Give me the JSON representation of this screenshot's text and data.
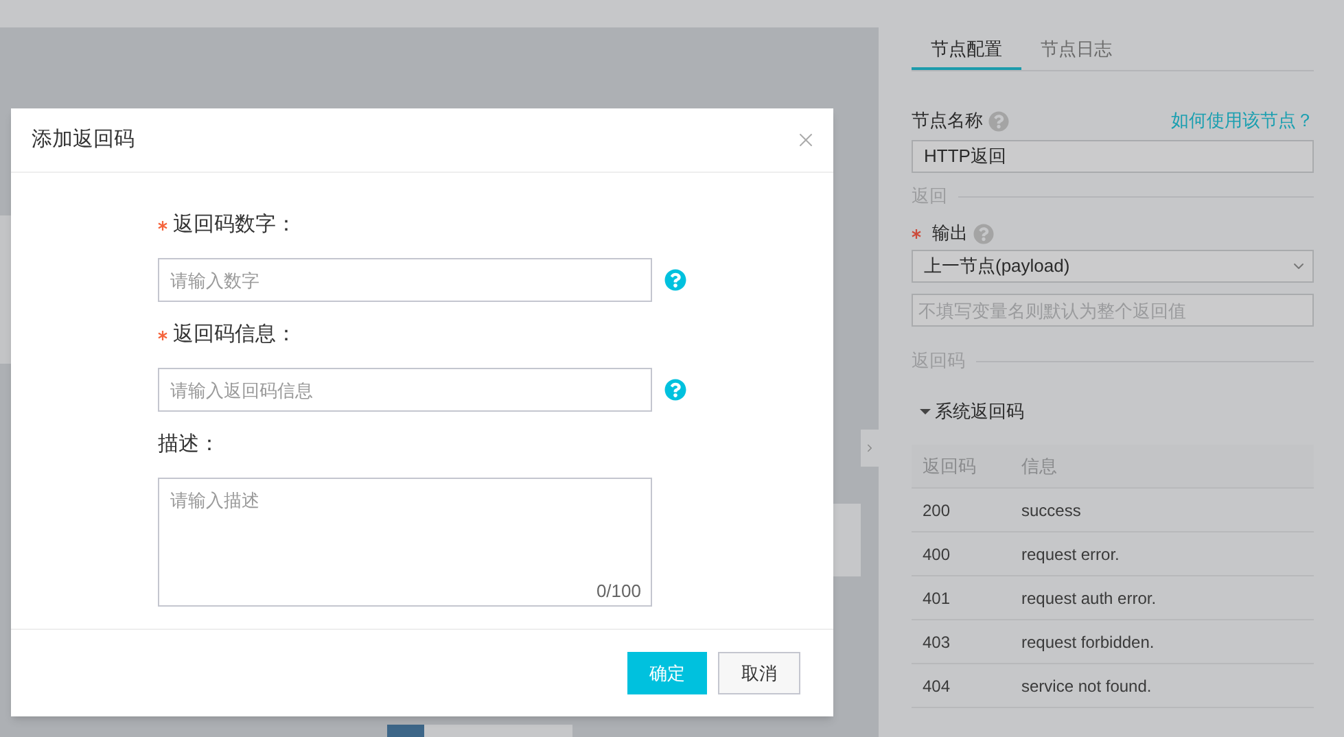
{
  "dialog": {
    "title": "添加返回码",
    "fields": [
      {
        "kind": "input",
        "label": "返回码数字：",
        "required": true,
        "placeholder": "请输入数字",
        "help": true
      },
      {
        "kind": "input",
        "label": "返回码信息：",
        "required": true,
        "placeholder": "请输入返回码信息",
        "help": true
      },
      {
        "kind": "textarea",
        "label": "描述：",
        "required": false,
        "placeholder": "请输入描述",
        "counter": "0/100"
      }
    ],
    "buttons": [
      {
        "label": "确定",
        "primary": true
      },
      {
        "label": "取消",
        "primary": false
      }
    ]
  },
  "panel": {
    "tabs": [
      {
        "label": "节点配置",
        "selected": true
      },
      {
        "label": "节点日志",
        "selected": false
      }
    ],
    "name_label": "节点名称",
    "help_link": "如何使用该节点？",
    "name_value": "HTTP返回",
    "section_return": "返回",
    "output_label": "输出",
    "output_required": true,
    "output_value": "上一节点(payload)",
    "variable_placeholder": "不填写变量名则默认为整个返回值",
    "section_codes": "返回码",
    "system_codes": {
      "title": "系统返回码",
      "expanded": true,
      "columns": [
        "返回码",
        "信息"
      ],
      "rows": [
        [
          "200",
          "success"
        ],
        [
          "400",
          "request error."
        ],
        [
          "401",
          "request auth error."
        ],
        [
          "403",
          "request forbidden."
        ],
        [
          "404",
          "service not found."
        ]
      ]
    }
  }
}
